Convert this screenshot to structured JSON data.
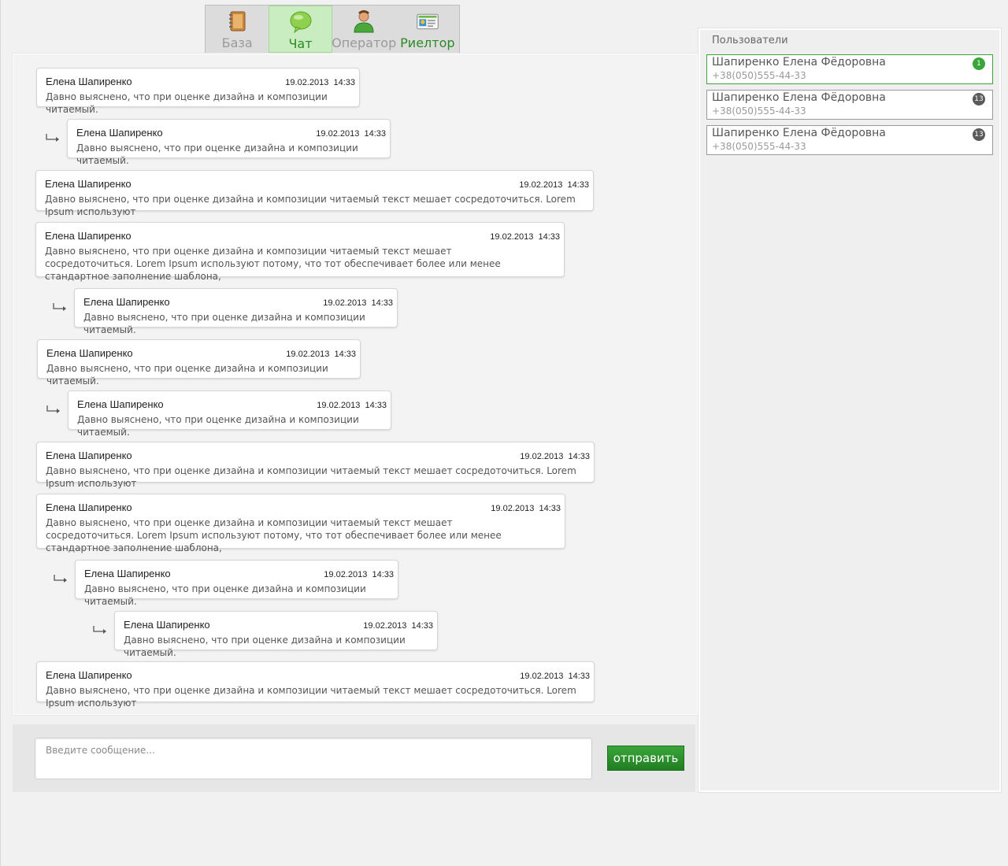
{
  "tabs": [
    {
      "label": "База",
      "icon": "notebook-icon"
    },
    {
      "label": "Чат",
      "icon": "speech-bubble-icon"
    },
    {
      "label": "Оператор",
      "icon": "operator-person-icon"
    },
    {
      "label": "Риелтор",
      "icon": "contact-card-icon"
    }
  ],
  "messages": [
    {
      "author": "Елена Шапиренко",
      "date": "19.02.2013",
      "time": "14:33",
      "text": "Давно выяснено, что при оценке дизайна и композиции читаемый."
    },
    {
      "author": "Елена Шапиренко",
      "date": "19.02.2013",
      "time": "14:33",
      "text": "Давно выяснено, что при оценке дизайна и композиции читаемый."
    },
    {
      "author": "Елена Шапиренко",
      "date": "19.02.2013",
      "time": "14:33",
      "text": "Давно выяснено, что при оценке дизайна и композиции читаемый текст мешает сосредоточиться. Lorem Ipsum используют"
    },
    {
      "author": "Елена Шапиренко",
      "date": "19.02.2013",
      "time": "14:33",
      "text": "Давно выяснено, что при оценке дизайна и композиции читаемый текст мешает сосредоточиться. Lorem Ipsum используют потому, что тот обеспечивает более или менее стандартное заполнение шаблона,"
    },
    {
      "author": "Елена Шапиренко",
      "date": "19.02.2013",
      "time": "14:33",
      "text": "Давно выяснено, что при оценке дизайна и композиции читаемый."
    },
    {
      "author": "Елена Шапиренко",
      "date": "19.02.2013",
      "time": "14:33",
      "text": "Давно выяснено, что при оценке дизайна и композиции читаемый."
    },
    {
      "author": "Елена Шапиренко",
      "date": "19.02.2013",
      "time": "14:33",
      "text": "Давно выяснено, что при оценке дизайна и композиции читаемый."
    },
    {
      "author": "Елена Шапиренко",
      "date": "19.02.2013",
      "time": "14:33",
      "text": "Давно выяснено, что при оценке дизайна и композиции читаемый текст мешает сосредоточиться. Lorem Ipsum используют"
    },
    {
      "author": "Елена Шапиренко",
      "date": "19.02.2013",
      "time": "14:33",
      "text": "Давно выяснено, что при оценке дизайна и композиции читаемый текст мешает сосредоточиться. Lorem Ipsum используют потому, что тот обеспечивает более или менее стандартное заполнение шаблона,"
    },
    {
      "author": "Елена Шапиренко",
      "date": "19.02.2013",
      "time": "14:33",
      "text": "Давно выяснено, что при оценке дизайна и композиции читаемый."
    },
    {
      "author": "Елена Шапиренко",
      "date": "19.02.2013",
      "time": "14:33",
      "text": "Давно выяснено, что при оценке дизайна и композиции читаемый."
    },
    {
      "author": "Елена Шапиренко",
      "date": "19.02.2013",
      "time": "14:33",
      "text": "Давно выяснено, что при оценке дизайна и композиции читаемый текст мешает сосредоточиться. Lorem Ipsum используют"
    }
  ],
  "composer": {
    "placeholder": "Введите сообщение...",
    "send_label": "отправить"
  },
  "users": {
    "title": "Пользователи",
    "items": [
      {
        "name": "Шапиренко Елена Фёдоровна",
        "phone": "+38(050)555-44-33",
        "badge": "1"
      },
      {
        "name": "Шапиренко Елена Фёдоровна",
        "phone": "+38(050)555-44-33",
        "badge": "13"
      },
      {
        "name": "Шапиренко Елена Фёдоровна",
        "phone": "+38(050)555-44-33",
        "badge": "13"
      }
    ]
  },
  "colors": {
    "accent": "#2a8a24",
    "badge_active": "#3aa53a",
    "badge_inactive": "#5a5a5a"
  }
}
